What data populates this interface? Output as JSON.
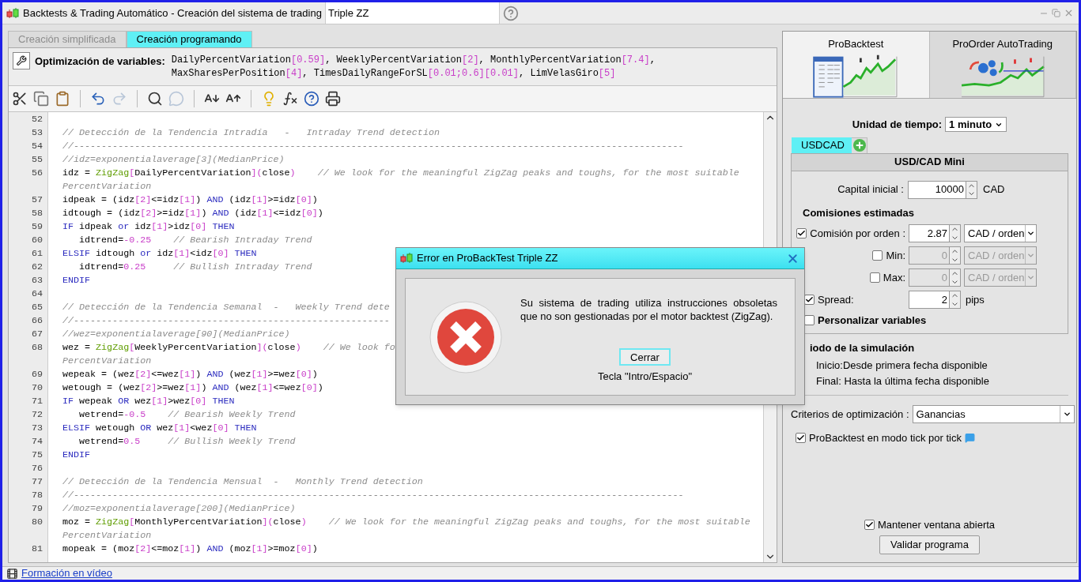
{
  "window": {
    "title": "Backtests & Trading Automático - Creación del sistema de trading",
    "system_name": "Triple ZZ"
  },
  "editor_tabs": [
    {
      "label": "Creación simplificada",
      "selected": false
    },
    {
      "label": "Creación programando",
      "selected": true
    }
  ],
  "optimization": {
    "label": "Optimización de variables:",
    "lines": [
      [
        {
          "kind": "plain",
          "text": "DailyPercentVariation"
        },
        {
          "kind": "number",
          "text": "[0.59]"
        },
        {
          "kind": "plain",
          "text": ", WeeklyPercentVariation"
        },
        {
          "kind": "number",
          "text": "[2]"
        },
        {
          "kind": "plain",
          "text": ", MonthlyPercentVariation"
        },
        {
          "kind": "number",
          "text": "[7.4]"
        },
        {
          "kind": "plain",
          "text": ","
        }
      ],
      [
        {
          "kind": "plain",
          "text": "MaxSharesPerPosition"
        },
        {
          "kind": "number",
          "text": "[4]"
        },
        {
          "kind": "plain",
          "text": ", TimesDailyRangeForSL"
        },
        {
          "kind": "number",
          "text": "[0.01;0.6][0.01]"
        },
        {
          "kind": "plain",
          "text": ", LimVelasGiro"
        },
        {
          "kind": "number",
          "text": "[5]"
        }
      ]
    ]
  },
  "toolbar": [
    {
      "kind": "cut",
      "disabled": false
    },
    {
      "kind": "copy",
      "disabled": false
    },
    {
      "kind": "paste",
      "disabled": false
    },
    {
      "kind": "separator"
    },
    {
      "kind": "undo",
      "disabled": false
    },
    {
      "kind": "redo",
      "disabled": true
    },
    {
      "kind": "separator"
    },
    {
      "kind": "search",
      "disabled": false
    },
    {
      "kind": "comment",
      "disabled": true
    },
    {
      "kind": "separator"
    },
    {
      "kind": "font_smaller",
      "disabled": false
    },
    {
      "kind": "font_larger",
      "disabled": false
    },
    {
      "kind": "separator"
    },
    {
      "kind": "hint",
      "disabled": false
    },
    {
      "kind": "function",
      "disabled": false
    },
    {
      "kind": "help",
      "disabled": false
    },
    {
      "kind": "print",
      "disabled": false
    }
  ],
  "code": [
    {
      "number": "52"
    },
    {
      "number": "53",
      "tokens": [
        {
          "kind": "comment",
          "text": "// Detección de la Tendencia Intradía   -   Intraday Trend detection"
        }
      ]
    },
    {
      "number": "54",
      "tokens": [
        {
          "kind": "comment",
          "text": "//--------------------------------------------------------------------------------------------------------------"
        }
      ]
    },
    {
      "number": "55",
      "tokens": [
        {
          "kind": "comment",
          "text": "//idz=exponentialaverage[3](MedianPrice)"
        }
      ]
    },
    {
      "number": "56",
      "tokens": [
        {
          "kind": "plain",
          "text": "idz = "
        },
        {
          "kind": "function",
          "text": "ZigZag"
        },
        {
          "kind": "number",
          "text": "["
        },
        {
          "kind": "plain",
          "text": "DailyPercentVariation"
        },
        {
          "kind": "number",
          "text": "]("
        },
        {
          "kind": "plain",
          "text": "close"
        },
        {
          "kind": "number",
          "text": ")"
        },
        {
          "kind": "comment",
          "text": "    // We look for the meaningful ZigZag peaks and toughs, for the most suitable"
        }
      ]
    },
    {
      "tokens": [
        {
          "kind": "comment",
          "text": "PercentVariation"
        }
      ]
    },
    {
      "number": "57",
      "tokens": [
        {
          "kind": "plain",
          "text": "idpeak = (idz"
        },
        {
          "kind": "number",
          "text": "[2]"
        },
        {
          "kind": "plain",
          "text": "<=idz"
        },
        {
          "kind": "number",
          "text": "[1]"
        },
        {
          "kind": "plain",
          "text": ") "
        },
        {
          "kind": "keyword",
          "text": "AND"
        },
        {
          "kind": "plain",
          "text": " (idz"
        },
        {
          "kind": "number",
          "text": "[1]"
        },
        {
          "kind": "plain",
          "text": ">=idz"
        },
        {
          "kind": "number",
          "text": "[0]"
        },
        {
          "kind": "plain",
          "text": ")"
        }
      ]
    },
    {
      "number": "58",
      "tokens": [
        {
          "kind": "plain",
          "text": "idtough = (idz"
        },
        {
          "kind": "number",
          "text": "[2]"
        },
        {
          "kind": "plain",
          "text": ">=idz"
        },
        {
          "kind": "number",
          "text": "[1]"
        },
        {
          "kind": "plain",
          "text": ") "
        },
        {
          "kind": "keyword",
          "text": "AND"
        },
        {
          "kind": "plain",
          "text": " (idz"
        },
        {
          "kind": "number",
          "text": "[1]"
        },
        {
          "kind": "plain",
          "text": "<=idz"
        },
        {
          "kind": "number",
          "text": "[0]"
        },
        {
          "kind": "plain",
          "text": ")"
        }
      ]
    },
    {
      "number": "59",
      "tokens": [
        {
          "kind": "keyword",
          "text": "IF"
        },
        {
          "kind": "plain",
          "text": " idpeak "
        },
        {
          "kind": "keyword",
          "text": "or"
        },
        {
          "kind": "plain",
          "text": " idz"
        },
        {
          "kind": "number",
          "text": "[1]"
        },
        {
          "kind": "plain",
          "text": ">idz"
        },
        {
          "kind": "number",
          "text": "[0]"
        },
        {
          "kind": "keyword",
          "text": " THEN"
        }
      ]
    },
    {
      "number": "60",
      "tokens": [
        {
          "kind": "plain",
          "text": "   idtrend="
        },
        {
          "kind": "number",
          "text": "-0.25"
        },
        {
          "kind": "comment",
          "text": "    // Bearish Intraday Trend"
        }
      ]
    },
    {
      "number": "61",
      "tokens": [
        {
          "kind": "keyword",
          "text": "ELSIF"
        },
        {
          "kind": "plain",
          "text": " idtough "
        },
        {
          "kind": "keyword",
          "text": "or"
        },
        {
          "kind": "plain",
          "text": " idz"
        },
        {
          "kind": "number",
          "text": "[1]"
        },
        {
          "kind": "plain",
          "text": "<idz"
        },
        {
          "kind": "number",
          "text": "[0]"
        },
        {
          "kind": "keyword",
          "text": " THEN"
        }
      ]
    },
    {
      "number": "62",
      "tokens": [
        {
          "kind": "plain",
          "text": "   idtrend="
        },
        {
          "kind": "number",
          "text": "0.25"
        },
        {
          "kind": "comment",
          "text": "     // Bullish Intraday Trend"
        }
      ]
    },
    {
      "number": "63",
      "tokens": [
        {
          "kind": "keyword",
          "text": "ENDIF"
        }
      ]
    },
    {
      "number": "64"
    },
    {
      "number": "65",
      "tokens": [
        {
          "kind": "comment",
          "text": "// Detección de la Tendencia Semanal  -   Weekly Trend dete"
        }
      ]
    },
    {
      "number": "66",
      "tokens": [
        {
          "kind": "comment",
          "text": "//---------------------------------------------------------"
        }
      ]
    },
    {
      "number": "67",
      "tokens": [
        {
          "kind": "comment",
          "text": "//wez=exponentialaverage[90](MedianPrice)"
        }
      ]
    },
    {
      "number": "68",
      "tokens": [
        {
          "kind": "plain",
          "text": "wez = "
        },
        {
          "kind": "function",
          "text": "ZigZag"
        },
        {
          "kind": "number",
          "text": "["
        },
        {
          "kind": "plain",
          "text": "WeeklyPercentVariation"
        },
        {
          "kind": "number",
          "text": "]("
        },
        {
          "kind": "plain",
          "text": "close"
        },
        {
          "kind": "number",
          "text": ")"
        },
        {
          "kind": "comment",
          "text": "    // We look fo"
        }
      ]
    },
    {
      "tokens": [
        {
          "kind": "comment",
          "text": "PercentVariation"
        }
      ]
    },
    {
      "number": "69",
      "tokens": [
        {
          "kind": "plain",
          "text": "wepeak = (wez"
        },
        {
          "kind": "number",
          "text": "[2]"
        },
        {
          "kind": "plain",
          "text": "<=wez"
        },
        {
          "kind": "number",
          "text": "[1]"
        },
        {
          "kind": "plain",
          "text": ") "
        },
        {
          "kind": "keyword",
          "text": "AND"
        },
        {
          "kind": "plain",
          "text": " (wez"
        },
        {
          "kind": "number",
          "text": "[1]"
        },
        {
          "kind": "plain",
          "text": ">=wez"
        },
        {
          "kind": "number",
          "text": "[0]"
        },
        {
          "kind": "plain",
          "text": ")"
        }
      ]
    },
    {
      "number": "70",
      "tokens": [
        {
          "kind": "plain",
          "text": "wetough = (wez"
        },
        {
          "kind": "number",
          "text": "[2]"
        },
        {
          "kind": "plain",
          "text": ">=wez"
        },
        {
          "kind": "number",
          "text": "[1]"
        },
        {
          "kind": "plain",
          "text": ") "
        },
        {
          "kind": "keyword",
          "text": "AND"
        },
        {
          "kind": "plain",
          "text": " (wez"
        },
        {
          "kind": "number",
          "text": "[1]"
        },
        {
          "kind": "plain",
          "text": "<=wez"
        },
        {
          "kind": "number",
          "text": "[0]"
        },
        {
          "kind": "plain",
          "text": ")"
        }
      ]
    },
    {
      "number": "71",
      "tokens": [
        {
          "kind": "keyword",
          "text": "IF"
        },
        {
          "kind": "plain",
          "text": " wepeak "
        },
        {
          "kind": "keyword",
          "text": "OR"
        },
        {
          "kind": "plain",
          "text": " wez"
        },
        {
          "kind": "number",
          "text": "[1]"
        },
        {
          "kind": "plain",
          "text": ">wez"
        },
        {
          "kind": "number",
          "text": "[0]"
        },
        {
          "kind": "keyword",
          "text": " THEN"
        }
      ]
    },
    {
      "number": "72",
      "tokens": [
        {
          "kind": "plain",
          "text": "   wetrend="
        },
        {
          "kind": "number",
          "text": "-0.5"
        },
        {
          "kind": "comment",
          "text": "    // Bearish Weekly Trend"
        }
      ]
    },
    {
      "number": "73",
      "tokens": [
        {
          "kind": "keyword",
          "text": "ELSIF"
        },
        {
          "kind": "plain",
          "text": " wetough "
        },
        {
          "kind": "keyword",
          "text": "OR"
        },
        {
          "kind": "plain",
          "text": " wez"
        },
        {
          "kind": "number",
          "text": "[1]"
        },
        {
          "kind": "plain",
          "text": "<wez"
        },
        {
          "kind": "number",
          "text": "[0]"
        },
        {
          "kind": "keyword",
          "text": " THEN"
        }
      ]
    },
    {
      "number": "74",
      "tokens": [
        {
          "kind": "plain",
          "text": "   wetrend="
        },
        {
          "kind": "number",
          "text": "0.5"
        },
        {
          "kind": "comment",
          "text": "     // Bullish Weekly Trend"
        }
      ]
    },
    {
      "number": "75",
      "tokens": [
        {
          "kind": "keyword",
          "text": "ENDIF"
        }
      ]
    },
    {
      "number": "76"
    },
    {
      "number": "77",
      "tokens": [
        {
          "kind": "comment",
          "text": "// Detección de la Tendencia Mensual  -   Monthly Trend detection"
        }
      ]
    },
    {
      "number": "78",
      "tokens": [
        {
          "kind": "comment",
          "text": "//--------------------------------------------------------------------------------------------------------------"
        }
      ]
    },
    {
      "number": "79",
      "tokens": [
        {
          "kind": "comment",
          "text": "//moz=exponentialaverage[200](MedianPrice)"
        }
      ]
    },
    {
      "number": "80",
      "tokens": [
        {
          "kind": "plain",
          "text": "moz = "
        },
        {
          "kind": "function",
          "text": "ZigZag"
        },
        {
          "kind": "number",
          "text": "["
        },
        {
          "kind": "plain",
          "text": "MonthlyPercentVariation"
        },
        {
          "kind": "number",
          "text": "]("
        },
        {
          "kind": "plain",
          "text": "close"
        },
        {
          "kind": "number",
          "text": ")"
        },
        {
          "kind": "comment",
          "text": "    // We look for the meaningful ZigZag peaks and toughs, for the most suitable"
        }
      ]
    },
    {
      "tokens": [
        {
          "kind": "comment",
          "text": "PercentVariation"
        }
      ]
    },
    {
      "number": "81",
      "tokens": [
        {
          "kind": "plain",
          "text": "mopeak = (moz"
        },
        {
          "kind": "number",
          "text": "[2]"
        },
        {
          "kind": "plain",
          "text": "<=moz"
        },
        {
          "kind": "number",
          "text": "[1]"
        },
        {
          "kind": "plain",
          "text": ") "
        },
        {
          "kind": "keyword",
          "text": "AND"
        },
        {
          "kind": "plain",
          "text": " (moz"
        },
        {
          "kind": "number",
          "text": "[1]"
        },
        {
          "kind": "plain",
          "text": ">=moz"
        },
        {
          "kind": "number",
          "text": "[0]"
        },
        {
          "kind": "plain",
          "text": ")"
        }
      ]
    }
  ],
  "right_panel": {
    "tabs": [
      {
        "label": "ProBacktest",
        "selected": true
      },
      {
        "label": "ProOrder AutoTrading",
        "selected": false
      }
    ],
    "timeframe": {
      "label": "Unidad de tiempo:",
      "value": "1 minuto"
    },
    "instrument_tabs": [
      {
        "label": "USDCAD",
        "selected": true
      }
    ],
    "instrument_title": "USD/CAD Mini",
    "capital": {
      "label": "Capital inicial :",
      "value": "10000",
      "unit": "CAD"
    },
    "commissions_heading": "Comisiones estimadas",
    "commission_rows": [
      {
        "label": "Comisión por orden :",
        "checked": true,
        "disabled": false,
        "value": "2.87",
        "unit": "CAD / orden"
      },
      {
        "label": "Min:",
        "checked": false,
        "disabled": true,
        "value": "0",
        "unit": "CAD / orden"
      },
      {
        "label": "Max:",
        "checked": false,
        "disabled": true,
        "value": "0",
        "unit": "CAD / orden"
      }
    ],
    "spread": {
      "label": "Spread:",
      "checked": true,
      "value": "2",
      "unit": "pips"
    },
    "custom_variables": {
      "label": "Personalizar variables",
      "checked": false
    },
    "period_heading": "iodo de la simulación",
    "period_lines": [
      "Inicio:Desde primera fecha disponible",
      "Final: Hasta la última fecha disponible"
    ],
    "criteria": {
      "label": "Criterios de optimización :",
      "value": "Ganancias"
    },
    "tick_mode": {
      "label": "ProBacktest en modo tick por tick",
      "checked": true
    },
    "keep_open": {
      "label": "Mantener ventana abierta",
      "checked": true
    },
    "validate_button": "Validar programa"
  },
  "dialog": {
    "title": "Error en ProBackTest Triple ZZ",
    "message": "Su sistema de trading utiliza instrucciones obsoletas que no son gestionadas por el motor backtest (ZigZag).",
    "button": "Cerrar",
    "hint": "Tecla \"Intro/Espacio\""
  },
  "status_bar": {
    "link": "Formación en vídeo"
  }
}
